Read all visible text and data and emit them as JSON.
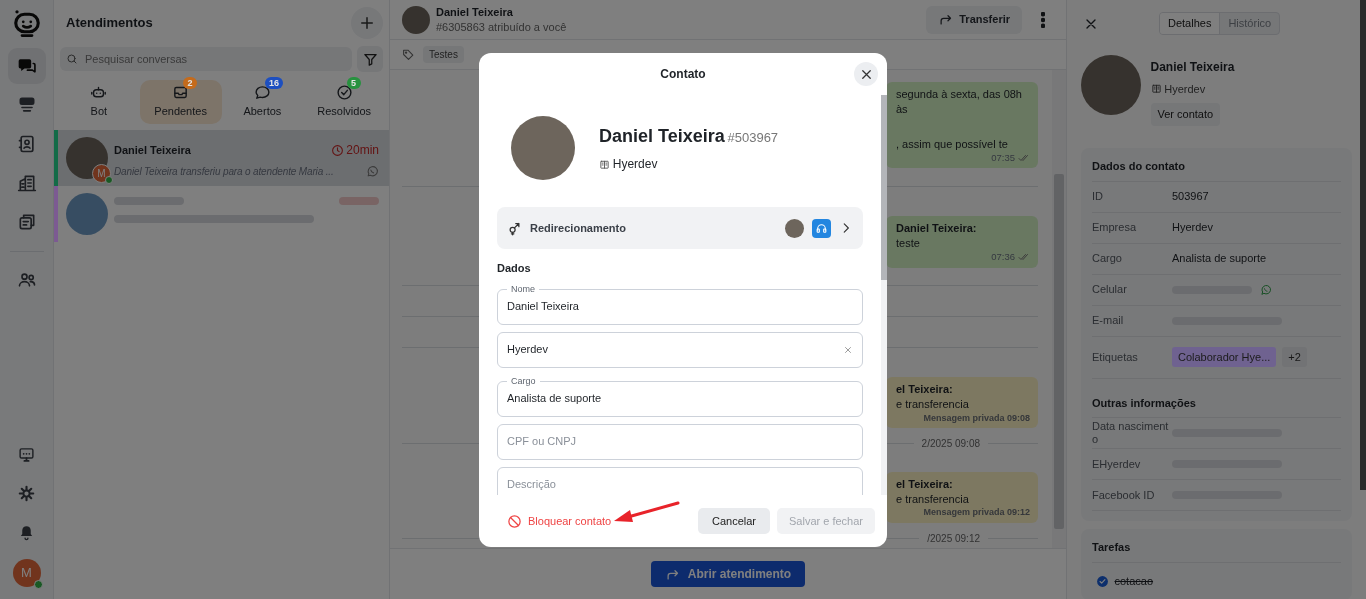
{
  "rail": {
    "items": [
      {
        "selected": true
      },
      {
        "selected": false
      },
      {
        "selected": false
      },
      {
        "selected": false
      },
      {
        "selected": false
      },
      {
        "selected": false
      }
    ],
    "bottom_items": [
      {
        "selected": false
      },
      {
        "selected": false
      },
      {
        "selected": false
      }
    ],
    "user": {
      "initial": "M",
      "online": true
    }
  },
  "conversations": {
    "title": "Atendimentos",
    "search": {
      "placeholder": "Pesquisar conversas"
    },
    "tabs": [
      {
        "label": "Bot",
        "selected": false
      },
      {
        "label": "Pendentes",
        "count": "2",
        "color": "#c46b1c",
        "selected": true
      },
      {
        "label": "Abertos",
        "count": "16",
        "color": "#1d4fc0",
        "selected": false
      },
      {
        "label": "Resolvidos",
        "count": "5",
        "color": "#27923f",
        "selected": false
      }
    ],
    "items": [
      {
        "name": "Daniel Teixeira",
        "time": "20min",
        "preview": "Daniel Teixeira transferiu para o atendente Maria ...",
        "agent_initial": "M",
        "agent_online": true,
        "color": "#136b47",
        "selected": true
      },
      {
        "color": "#7c5a92",
        "selected": false
      }
    ]
  },
  "chat": {
    "name": "Daniel Teixeira",
    "subtitle": "#6305863 atribuído a você",
    "transfer": "Transferir",
    "tag": "Testes",
    "messages": [
      {
        "kind": "bubble",
        "lines": [
          "segunda à sexta, das 08h às",
          ", assim que possível te"
        ],
        "time": "07:35",
        "read": true
      },
      {
        "kind": "divider"
      },
      {
        "kind": "bubble",
        "sender": "Daniel Teixeira:",
        "lines": [
          "teste"
        ],
        "time": "07:36",
        "read": true
      },
      {
        "kind": "divider"
      },
      {
        "kind": "divider"
      },
      {
        "kind": "divider"
      },
      {
        "kind": "private",
        "sender": "el Teixeira:",
        "text": "e transferencia",
        "footer": "Mensagem privada 09:08"
      },
      {
        "kind": "date",
        "text": "2/2025 09:08"
      },
      {
        "kind": "private",
        "sender": "el Teixeira:",
        "text": "e transferencia",
        "footer": "Mensagem privada 09:12"
      },
      {
        "kind": "date",
        "text": "/2025 09:12"
      }
    ],
    "open_button": "Abrir atendimento"
  },
  "details": {
    "tabs": [
      {
        "label": "Detalhes",
        "selected": true
      },
      {
        "label": "Histórico",
        "selected": false
      }
    ],
    "name": "Daniel Teixeira",
    "company": "Hyerdev",
    "view_button": "Ver contato",
    "contact_section": {
      "title": "Dados do contato",
      "rows": [
        {
          "kind": "text",
          "label": "ID",
          "value": "503967"
        },
        {
          "kind": "text",
          "label": "Empresa",
          "value": "Hyerdev"
        },
        {
          "kind": "text",
          "label": "Cargo",
          "value": "Analista de suporte"
        },
        {
          "kind": "blurred",
          "label": "Celular",
          "whatsapp": true
        },
        {
          "kind": "blurred",
          "label": "E-mail",
          "whatsapp": false
        },
        {
          "kind": "tags",
          "label": "Etiquetas",
          "tag": "Colaborador Hye...",
          "color": "#6f6290",
          "more": "+2"
        }
      ]
    },
    "other_section": {
      "title": "Outras informações",
      "rows": [
        {
          "kind": "blurred",
          "label": "Data nascimento",
          "whatsapp": false
        },
        {
          "kind": "blurred",
          "label": "EHyerdev",
          "whatsapp": false
        },
        {
          "kind": "blurred",
          "label": "Facebook ID",
          "whatsapp": false
        }
      ]
    },
    "tasks": {
      "title": "Tarefas",
      "items": [
        {
          "label": "cotacao",
          "done": true
        }
      ]
    }
  },
  "modal": {
    "title": "Contato",
    "name": "Daniel Teixeira",
    "id": "#503967",
    "company": "Hyerdev",
    "redirect": "Redirecionamento",
    "section": "Dados",
    "fields": [
      {
        "label": "Nome",
        "value": "Daniel Teixeira",
        "clearable": false
      },
      {
        "value": "Hyerdev",
        "clearable": true
      },
      {
        "label": "Cargo",
        "value": "Analista de suporte",
        "clearable": false
      },
      {
        "placeholder": "CPF ou CNPJ",
        "clearable": false
      },
      {
        "placeholder": "Descrição",
        "clearable": false
      }
    ],
    "block": "Bloquear contato",
    "cancel": "Cancelar",
    "save": {
      "label": "Salvar e fechar",
      "disabled": true
    }
  }
}
